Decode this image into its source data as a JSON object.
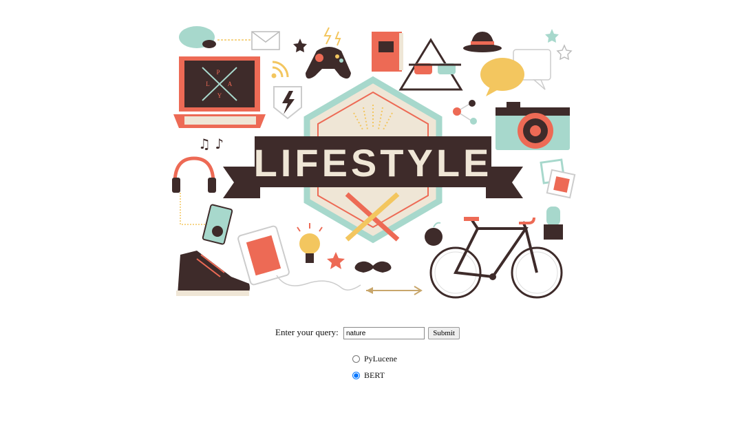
{
  "banner": {
    "title": "LIFESTYLE",
    "laptop_letters": [
      "P",
      "L",
      "A",
      "Y"
    ],
    "colors": {
      "dark": "#3e2b2a",
      "coral": "#ed6a55",
      "mint": "#a7d8cc",
      "yellow": "#f3c65f",
      "cream": "#efe6d6"
    }
  },
  "search": {
    "label": "Enter your query:",
    "query_value": "nature",
    "submit_label": "Submit"
  },
  "engines": [
    {
      "label": "PyLucene",
      "checked": false
    },
    {
      "label": "BERT",
      "checked": true
    }
  ]
}
